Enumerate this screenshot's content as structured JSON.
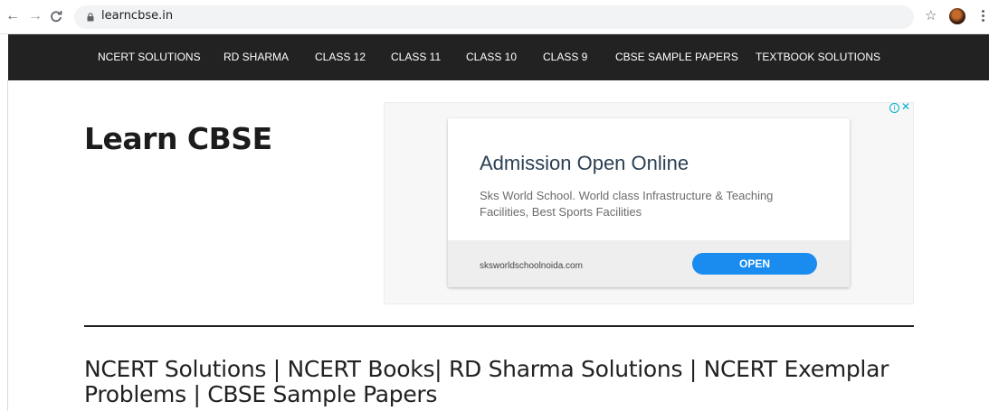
{
  "browser": {
    "url": "learncbse.in",
    "icons": {
      "back": "back-arrow-icon",
      "forward": "forward-arrow-icon",
      "reload": "reload-icon",
      "lock": "lock-icon",
      "bookmark": "star-icon",
      "menu": "kebab-menu-icon"
    }
  },
  "nav": {
    "items": [
      {
        "label": "NCERT SOLUTIONS"
      },
      {
        "label": "RD SHARMA"
      },
      {
        "label": "CLASS 12"
      },
      {
        "label": "CLASS 11"
      },
      {
        "label": "CLASS 10"
      },
      {
        "label": "CLASS 9"
      },
      {
        "label": "CBSE SAMPLE PAPERS"
      },
      {
        "label": "TEXTBOOK SOLUTIONS"
      }
    ],
    "background": "#222222"
  },
  "site": {
    "logo": "Learn CBSE"
  },
  "ad": {
    "headline": "Admission Open Online",
    "body": "Sks World School. World class Infrastructure & Teaching Facilities, Best Sports Facilities",
    "domain": "sksworldschoolnoida.com",
    "cta": "OPEN",
    "info_glyph": "i",
    "close_glyph": "✕",
    "accent": "#1a8cf0"
  },
  "main": {
    "heading": "NCERT Solutions | NCERT Books| RD Sharma Solutions | NCERT Exemplar Problems | CBSE Sample Papers"
  }
}
